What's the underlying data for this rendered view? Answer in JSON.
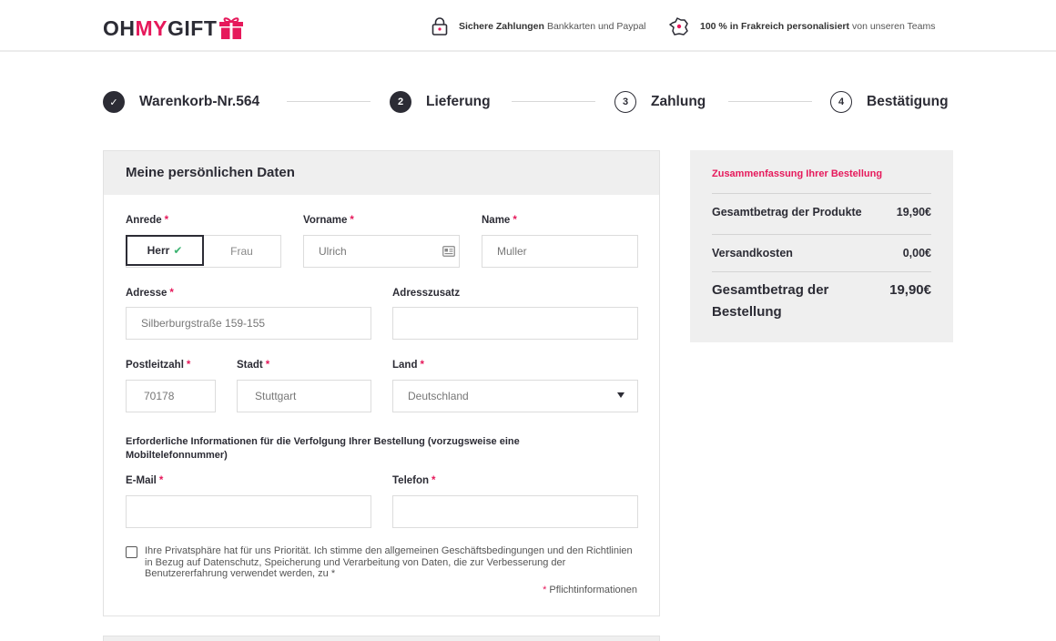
{
  "header": {
    "logo": {
      "oh": "OH",
      "my": "MY",
      "gift": "GIFT"
    },
    "trust": [
      {
        "icon": "lock-icon",
        "bold": "Sichere Zahlungen",
        "text": "Bankkarten und Paypal"
      },
      {
        "icon": "france-map-icon",
        "bold": "100 % in Frakreich personalisiert",
        "text": "von unseren Teams"
      }
    ]
  },
  "steps": [
    {
      "marker": "✓",
      "label": "Warenkorb-Nr.564",
      "state": "done"
    },
    {
      "marker": "2",
      "label": "Lieferung",
      "state": "current"
    },
    {
      "marker": "3",
      "label": "Zahlung",
      "state": "upcoming"
    },
    {
      "marker": "4",
      "label": "Bestätigung",
      "state": "upcoming"
    }
  ],
  "form": {
    "title": "Meine persönlichen Daten",
    "required_mark": "*",
    "anrede": {
      "label": "Anrede",
      "options": [
        "Herr",
        "Frau"
      ],
      "selected": "Herr"
    },
    "vorname": {
      "label": "Vorname",
      "value": "Ulrich"
    },
    "name": {
      "label": "Name",
      "value": "Muller"
    },
    "adresse": {
      "label": "Adresse",
      "value": "Silberburgstraße 159-155"
    },
    "adresszusatz": {
      "label": "Adresszusatz",
      "value": ""
    },
    "plz": {
      "label": "Postleitzahl",
      "value": "70178"
    },
    "stadt": {
      "label": "Stadt",
      "value": "Stuttgart"
    },
    "land": {
      "label": "Land",
      "value": "Deutschland"
    },
    "info": "Erforderliche Informationen für die Verfolgung Ihrer Bestellung (vorzugsweise eine Mobiltelefonnummer)",
    "email": {
      "label": "E-Mail",
      "value": ""
    },
    "telefon": {
      "label": "Telefon",
      "value": ""
    },
    "consent": "Ihre Privatsphäre hat für uns Priorität. Ich stimme den allgemeinen Geschäftsbedingungen und den Richtlinien in Bezug auf Datenschutz, Speicherung und Verarbeitung von Daten, die zur Verbesserung der Benutzererfahrung verwendet werden, zu *",
    "mandatory_note": "Pflichtinformationen"
  },
  "summary": {
    "title": "Zusammenfassung Ihrer Bestellung",
    "rows": [
      {
        "label": "Gesamtbetrag der Produkte",
        "value": "19,90€"
      },
      {
        "label": "Versandkosten",
        "value": "0,00€"
      },
      {
        "label": "Gesamtbetrag der Bestellung",
        "value": "19,90€"
      }
    ]
  },
  "colors": {
    "accent": "#e6195b",
    "dark": "#2c2c35",
    "panel": "#efefef",
    "check": "#3cb371"
  }
}
